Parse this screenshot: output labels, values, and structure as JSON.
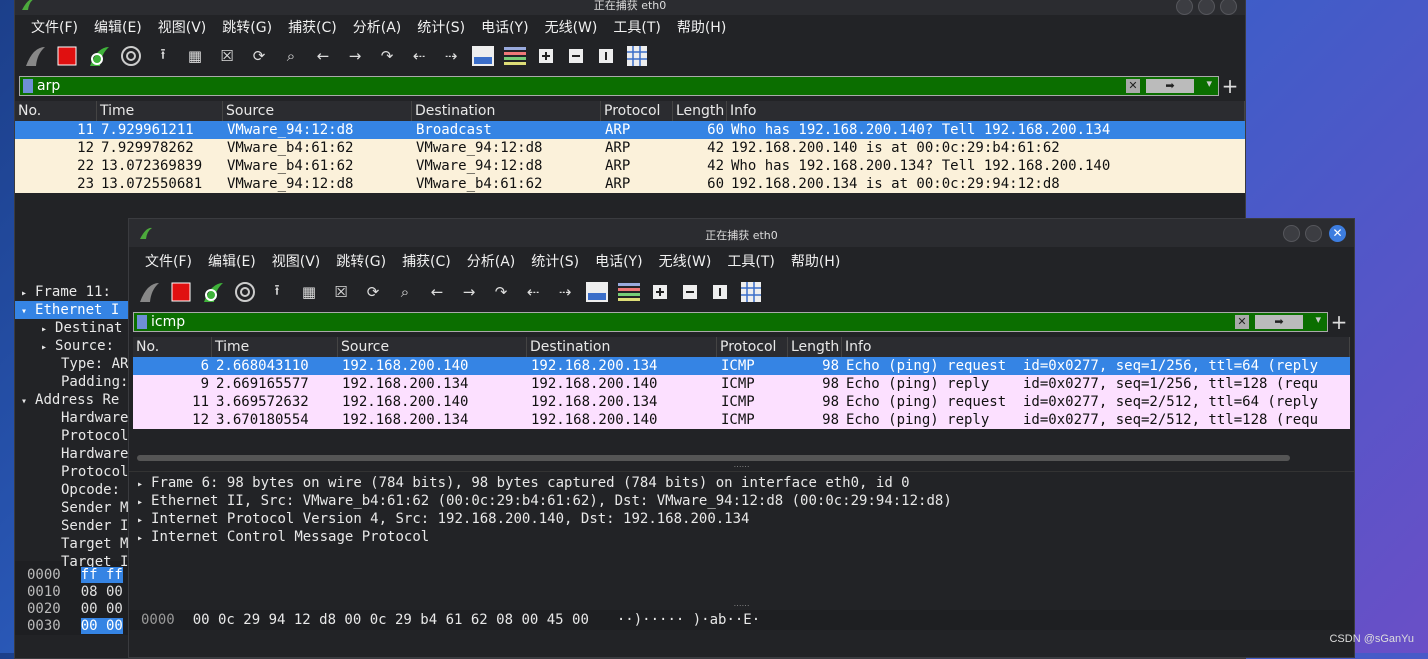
{
  "back_window": {
    "menu": [
      "文件(F)",
      "编辑(E)",
      "视图(V)",
      "跳转(G)",
      "捕获(C)",
      "分析(A)",
      "统计(S)",
      "电话(Y)",
      "无线(W)",
      "工具(T)",
      "帮助(H)"
    ],
    "title": "正在捕获 eth0",
    "filter": "arp",
    "columns": [
      "No.",
      "Time",
      "Source",
      "Destination",
      "Protocol",
      "Length",
      "Info"
    ],
    "rows": [
      {
        "no": "11",
        "time": "7.929961211",
        "src": "VMware_94:12:d8",
        "dst": "Broadcast",
        "proto": "ARP",
        "len": "60",
        "info": "Who has 192.168.200.140? Tell 192.168.200.134"
      },
      {
        "no": "12",
        "time": "7.929978262",
        "src": "VMware_b4:61:62",
        "dst": "VMware_94:12:d8",
        "proto": "ARP",
        "len": "42",
        "info": "192.168.200.140 is at 00:0c:29:b4:61:62"
      },
      {
        "no": "22",
        "time": "13.072369839",
        "src": "VMware_b4:61:62",
        "dst": "VMware_94:12:d8",
        "proto": "ARP",
        "len": "42",
        "info": "Who has 192.168.200.134? Tell 192.168.200.140"
      },
      {
        "no": "23",
        "time": "13.072550681",
        "src": "VMware_94:12:d8",
        "dst": "VMware_b4:61:62",
        "proto": "ARP",
        "len": "60",
        "info": "192.168.200.134 is at 00:0c:29:94:12:d8"
      }
    ],
    "details": [
      {
        "arrow": "▸",
        "indent": 0,
        "text": "Frame 11:"
      },
      {
        "arrow": "▾",
        "indent": 0,
        "text": "Ethernet I"
      },
      {
        "arrow": "▸",
        "indent": 1,
        "text": "Destinat"
      },
      {
        "arrow": "▸",
        "indent": 1,
        "text": "Source: "
      },
      {
        "arrow": "",
        "indent": 1,
        "text": "Type: AR"
      },
      {
        "arrow": "",
        "indent": 1,
        "text": "Padding:"
      },
      {
        "arrow": "▾",
        "indent": 0,
        "text": "Address Re"
      },
      {
        "arrow": "",
        "indent": 1,
        "text": "Hardware"
      },
      {
        "arrow": "",
        "indent": 1,
        "text": "Protocol"
      },
      {
        "arrow": "",
        "indent": 1,
        "text": "Hardware"
      },
      {
        "arrow": "",
        "indent": 1,
        "text": "Protocol"
      },
      {
        "arrow": "",
        "indent": 1,
        "text": "Opcode: "
      },
      {
        "arrow": "",
        "indent": 1,
        "text": "Sender M"
      },
      {
        "arrow": "",
        "indent": 1,
        "text": "Sender I"
      },
      {
        "arrow": "",
        "indent": 1,
        "text": "Target M"
      },
      {
        "arrow": "",
        "indent": 1,
        "text": "Target I"
      }
    ],
    "hex": [
      {
        "off": "0000",
        "bytes": "ff ff"
      },
      {
        "off": "0010",
        "bytes": "08 00"
      },
      {
        "off": "0020",
        "bytes": "00 00"
      },
      {
        "off": "0030",
        "bytes": "00 00"
      }
    ]
  },
  "front_window": {
    "title": "正在捕获 eth0",
    "menu": [
      "文件(F)",
      "编辑(E)",
      "视图(V)",
      "跳转(G)",
      "捕获(C)",
      "分析(A)",
      "统计(S)",
      "电话(Y)",
      "无线(W)",
      "工具(T)",
      "帮助(H)"
    ],
    "filter": "icmp",
    "columns": [
      "No.",
      "Time",
      "Source",
      "Destination",
      "Protocol",
      "Length",
      "Info"
    ],
    "rows": [
      {
        "no": "6",
        "time": "2.668043110",
        "src": "192.168.200.140",
        "dst": "192.168.200.134",
        "proto": "ICMP",
        "len": "98",
        "info": "Echo (ping) request  id=0x0277, seq=1/256, ttl=64 (reply"
      },
      {
        "no": "9",
        "time": "2.669165577",
        "src": "192.168.200.134",
        "dst": "192.168.200.140",
        "proto": "ICMP",
        "len": "98",
        "info": "Echo (ping) reply    id=0x0277, seq=1/256, ttl=128 (requ"
      },
      {
        "no": "11",
        "time": "3.669572632",
        "src": "192.168.200.140",
        "dst": "192.168.200.134",
        "proto": "ICMP",
        "len": "98",
        "info": "Echo (ping) request  id=0x0277, seq=2/512, ttl=64 (reply"
      },
      {
        "no": "12",
        "time": "3.670180554",
        "src": "192.168.200.134",
        "dst": "192.168.200.140",
        "proto": "ICMP",
        "len": "98",
        "info": "Echo (ping) reply    id=0x0277, seq=2/512, ttl=128 (requ"
      }
    ],
    "details": [
      "Frame 6: 98 bytes on wire (784 bits), 98 bytes captured (784 bits) on interface eth0, id 0",
      "Ethernet II, Src: VMware_b4:61:62 (00:0c:29:b4:61:62), Dst: VMware_94:12:d8 (00:0c:29:94:12:d8)",
      "Internet Protocol Version 4, Src: 192.168.200.140, Dst: 192.168.200.134",
      "Internet Control Message Protocol"
    ],
    "hex": {
      "off": "0000",
      "bytes": "00 0c 29 94 12 d8 00 0c  29 b4 61 62 08 00 45 00",
      "ascii": "··)····· )·ab··E·"
    }
  },
  "watermark": "CSDN @sGanYu",
  "colors": {
    "selected": "#3584e4",
    "arp_row": "#fbf1da",
    "icmp_row": "#fce0ff",
    "filter_ok": "#0b6e00"
  },
  "toolbar_icons": [
    "shark-fin-icon",
    "stop-icon",
    "restart-icon",
    "options-gear-icon",
    "open-icon",
    "save-icon",
    "close-file-icon",
    "reload-icon",
    "search-icon",
    "go-back-icon",
    "go-forward-icon",
    "go-to-packet-icon",
    "first-packet-icon",
    "last-packet-icon",
    "autoscroll-icon",
    "colorize-icon",
    "zoom-in-icon",
    "zoom-out-icon",
    "normal-size-icon",
    "resize-columns-icon"
  ]
}
